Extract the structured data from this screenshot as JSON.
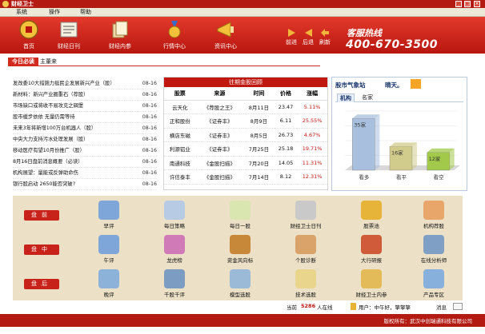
{
  "window": {
    "title": "财经卫士"
  },
  "menu": [
    "系统",
    "操作",
    "帮助"
  ],
  "toolbar": {
    "items": [
      {
        "label": "首页",
        "icon": "home-icon"
      },
      {
        "label": "财经日刊",
        "icon": "newspaper-icon"
      },
      {
        "label": "财经内参",
        "icon": "documents-icon"
      },
      {
        "label": "行情中心",
        "icon": "medal-icon"
      },
      {
        "label": "资讯中心",
        "icon": "megaphone-icon"
      }
    ],
    "nav": [
      {
        "label": "前进"
      },
      {
        "label": "后退"
      },
      {
        "label": "刷新"
      }
    ],
    "hotline_label": "客服热线",
    "hotline_number": "400-670-3500"
  },
  "ticker": {
    "badge": "今日必读",
    "text": "主董来"
  },
  "news": [
    {
      "title": "发改委10大措施力挺民企发展新兴产业（股）",
      "date": "08-16"
    },
    {
      "title": "新材料：新兴产业圈重石（荐股）",
      "date": "08-16"
    },
    {
      "title": "市场缺口或将收不易攻克之碉堡",
      "date": "08-16"
    },
    {
      "title": "股市缓步依依 无量仍需等待",
      "date": "08-16"
    },
    {
      "title": "未来3年将新增100万台机器人（股）",
      "date": "08-16"
    },
    {
      "title": "中央大力支持污水处理发展（股）",
      "date": "08-16"
    },
    {
      "title": "移动医疗有望10月份推广（股）",
      "date": "08-16"
    },
    {
      "title": "8月16日盘前消息概要（必读）",
      "date": "08-16"
    },
    {
      "title": "机构展望：量能或反弹助命伤",
      "date": "08-16"
    },
    {
      "title": "银行股启动 2650能否突破?",
      "date": "08-16"
    }
  ],
  "gold": {
    "title": "往期金股回顾",
    "headers": [
      "股票",
      "来源",
      "时间",
      "价格",
      "涨幅"
    ],
    "rows": [
      [
        "云天化",
        "《荐股之王》",
        "8月11日",
        "23.47",
        "5.11%"
      ],
      [
        "正和股份",
        "《证券丰》",
        "8月9日",
        "6.11",
        "25.55%"
      ],
      [
        "横店东磁",
        "《证券丰》",
        "8月5日",
        "26.73",
        "4.67%"
      ],
      [
        "利源铝业",
        "《证券丰》",
        "7月25日",
        "25.18",
        "19.71%"
      ],
      [
        "南通科技",
        "《金股扫描》",
        "7月20日",
        "14.05",
        "11.31%"
      ],
      [
        "许信泰丰",
        "《金股扫描》",
        "7月14日",
        "8.12",
        "12.31%"
      ]
    ]
  },
  "sentiment": {
    "title": "股市气象站",
    "weather": "晴天。",
    "tabs": [
      "机构",
      "名家"
    ],
    "colors": {
      "bullish": "#a8c0de",
      "neutral": "#d2cc8c",
      "bearish": "#a3c94a"
    }
  },
  "chart_data": {
    "type": "bar",
    "categories": [
      "看多",
      "看平",
      "看空"
    ],
    "values": [
      35,
      16,
      12
    ],
    "value_labels": [
      "35家",
      "16家",
      "12家"
    ],
    "ylim": [
      0,
      40
    ]
  },
  "functions": {
    "rows": [
      {
        "label": "盘前",
        "items": [
          {
            "label": "早评",
            "icon": "clipboard-icon",
            "color": "#7fa6d8"
          },
          {
            "label": "每日策略",
            "icon": "magnifier-icon",
            "color": "#b7cbe4"
          },
          {
            "label": "每日一股",
            "icon": "notepad-icon",
            "color": "#d9e6b0"
          },
          {
            "label": "财经卫士日刊",
            "icon": "newspaper-icon",
            "color": "#c9c9c9"
          },
          {
            "label": "股票池",
            "icon": "coins-icon",
            "color": "#e7b43a"
          },
          {
            "label": "机构荐股",
            "icon": "thumbsup-icon",
            "color": "#e8a66a"
          }
        ]
      },
      {
        "label": "盘中",
        "items": [
          {
            "label": "午评",
            "icon": "clipboard-pen-icon",
            "color": "#7fa6d8"
          },
          {
            "label": "龙虎榜",
            "icon": "pie-chart-icon",
            "color": "#d17ab8"
          },
          {
            "label": "资金风向标",
            "icon": "signpost-icon",
            "color": "#c7883a"
          },
          {
            "label": "个股诊断",
            "icon": "stethoscope-icon",
            "color": "#d9a36a"
          },
          {
            "label": "大行研报",
            "icon": "books-icon",
            "color": "#cf5b3a"
          },
          {
            "label": "在线分析师",
            "icon": "analyst-icon",
            "color": "#7f9fc4"
          }
        ]
      },
      {
        "label": "盘后",
        "items": [
          {
            "label": "晚评",
            "icon": "pencil-icon",
            "color": "#8db2d9"
          },
          {
            "label": "千股千评",
            "icon": "monitor-icon",
            "color": "#7d9cc2"
          },
          {
            "label": "模型选股",
            "icon": "flask-icon",
            "color": "#9bbad8"
          },
          {
            "label": "技术选股",
            "icon": "lamp-icon",
            "color": "#e9d68c"
          },
          {
            "label": "财经卫士内参",
            "icon": "folder-icon",
            "color": "#e3bb58"
          },
          {
            "label": "产品专区",
            "icon": "cube-icon",
            "color": "#88b0dc"
          }
        ]
      }
    ]
  },
  "status": {
    "online_prefix": "当前",
    "online_count": "5286",
    "online_suffix": "人在线",
    "user_label": "用户：中午好，擎擎擎",
    "message_label": "消息"
  },
  "footer": {
    "copyright": "版权所有：武汉中创瑞通科技有限公司"
  }
}
